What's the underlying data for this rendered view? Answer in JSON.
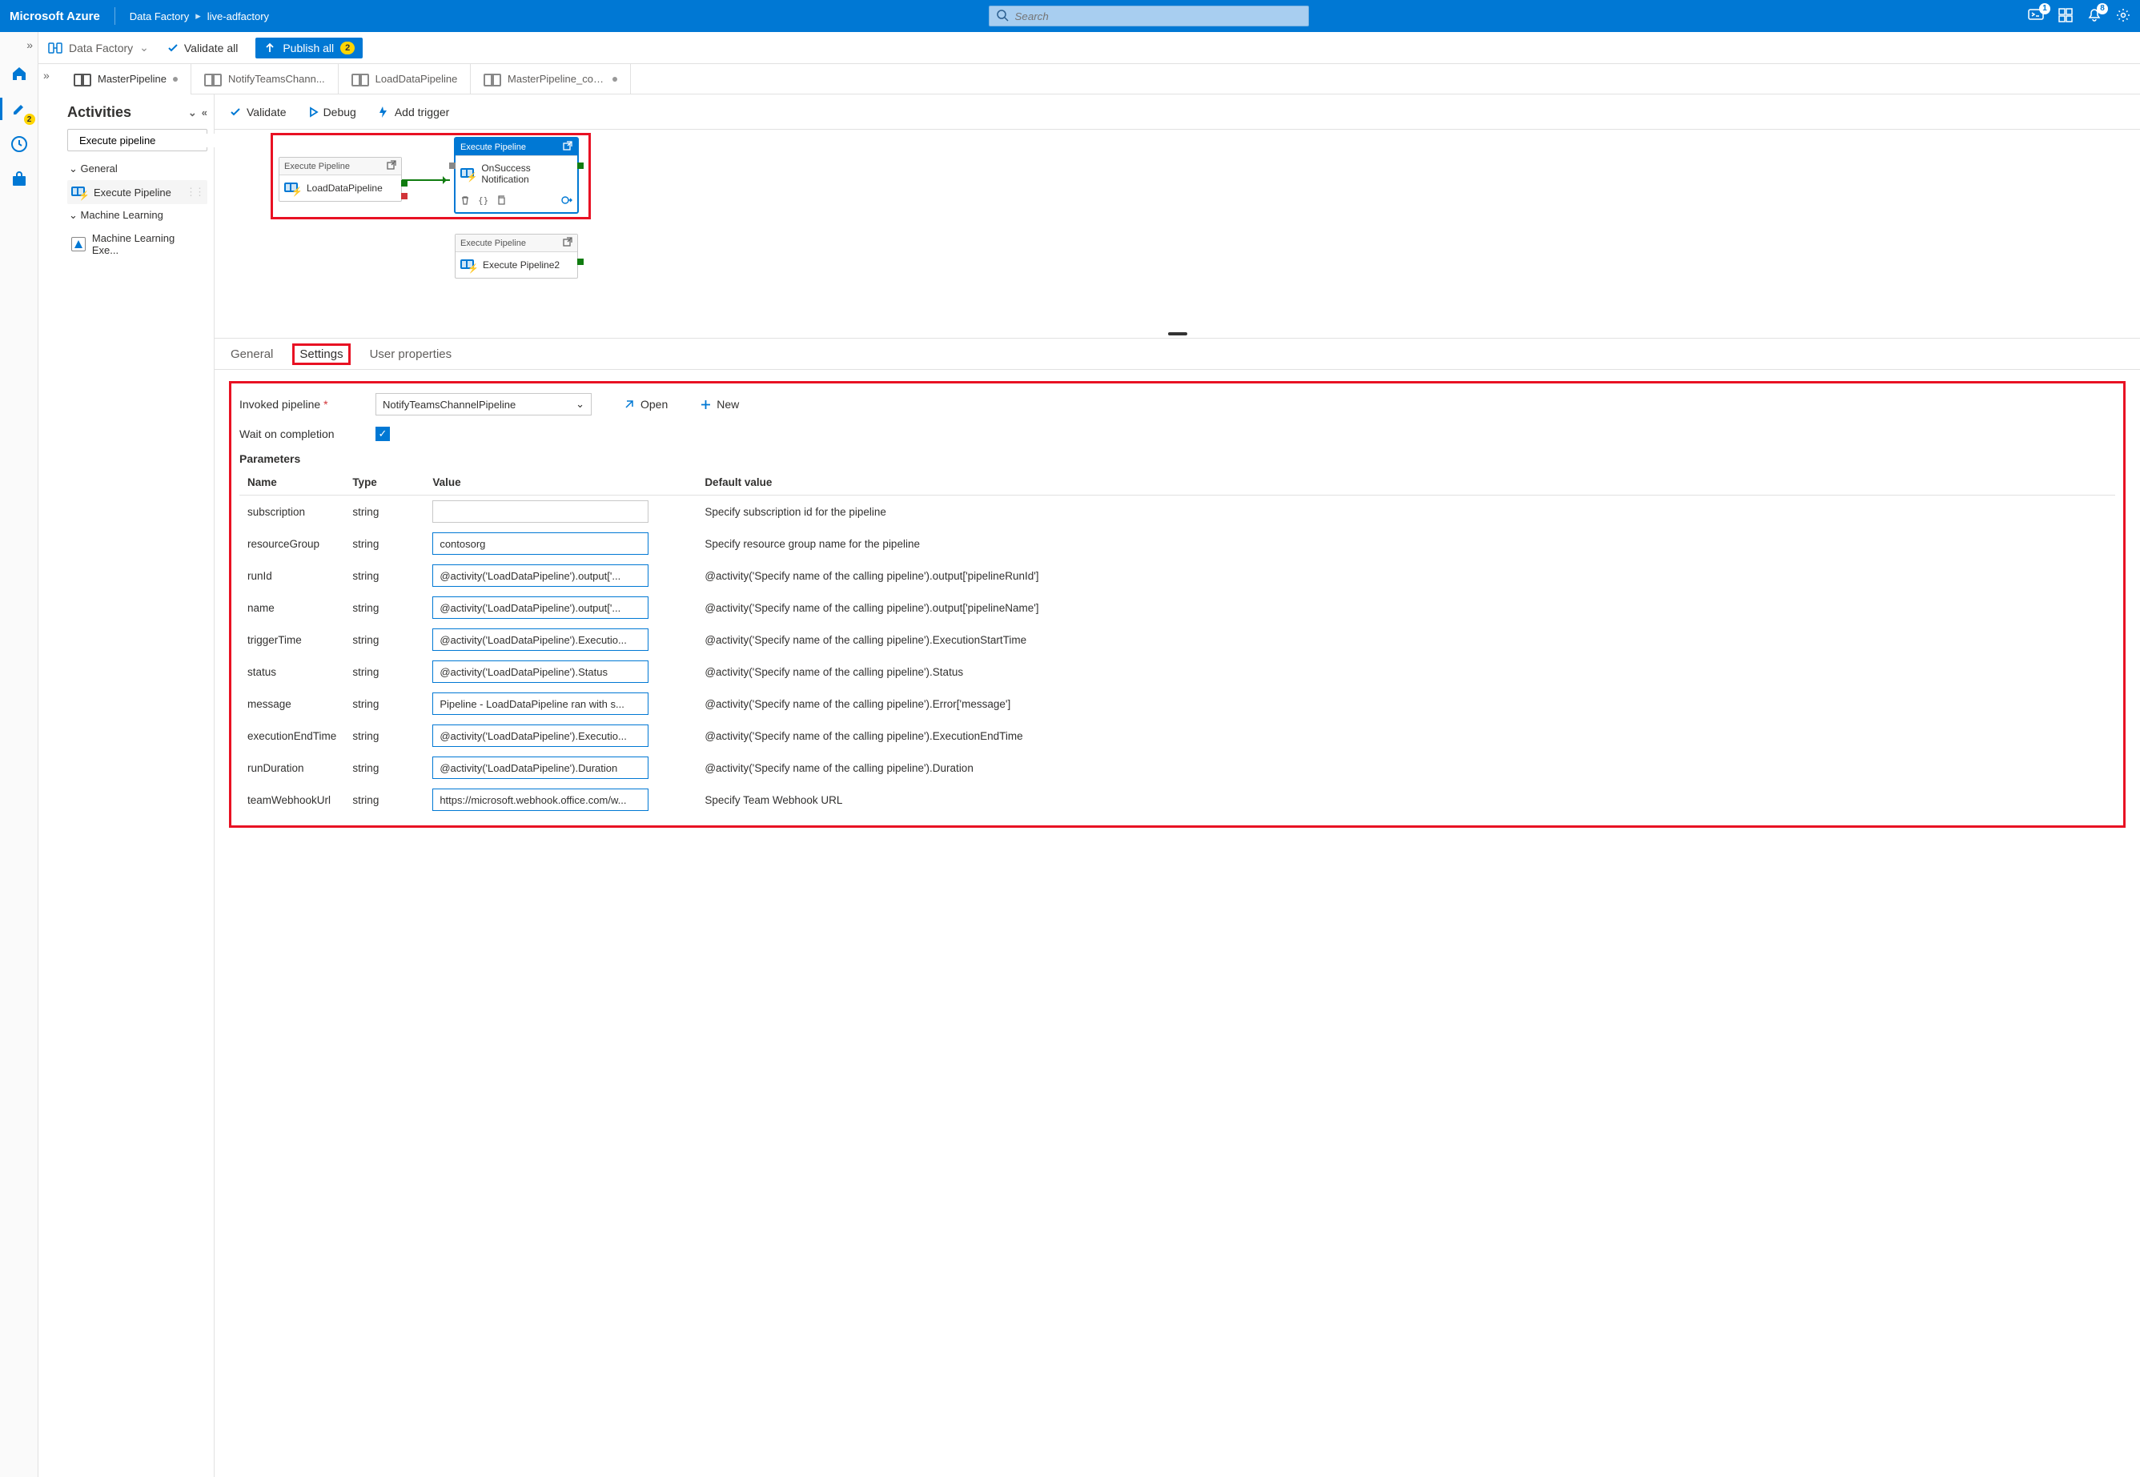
{
  "topbar": {
    "brand": "Microsoft Azure",
    "breadcrumb": [
      "Data Factory",
      "live-adfactory"
    ],
    "search_placeholder": "Search",
    "badges": {
      "chat": "1",
      "bell": "8"
    }
  },
  "cmdbar": {
    "scope": "Data Factory",
    "validate_all": "Validate all",
    "publish_all": "Publish all",
    "publish_count": "2"
  },
  "leftrail": {
    "pencil_count": "2"
  },
  "tabs": [
    {
      "label": "MasterPipeline",
      "dirty": true,
      "active": true
    },
    {
      "label": "NotifyTeamsChann...",
      "dirty": false,
      "active": false
    },
    {
      "label": "LoadDataPipeline",
      "dirty": false,
      "active": false
    },
    {
      "label": "MasterPipeline_cop...",
      "dirty": true,
      "active": false
    }
  ],
  "activities": {
    "title": "Activities",
    "search_value": "Execute pipeline",
    "groups": [
      {
        "name": "General",
        "items": [
          {
            "label": "Execute Pipeline",
            "icon": "exec"
          }
        ]
      },
      {
        "name": "Machine Learning",
        "items": [
          {
            "label": "Machine Learning Exe...",
            "icon": "ml"
          }
        ]
      }
    ]
  },
  "canvas_toolbar": {
    "validate": "Validate",
    "debug": "Debug",
    "add_trigger": "Add trigger"
  },
  "nodes": {
    "n1": {
      "type": "Execute Pipeline",
      "title": "LoadDataPipeline"
    },
    "n2": {
      "type": "Execute Pipeline",
      "title": "OnSuccess Notification"
    },
    "n3": {
      "type": "Execute Pipeline",
      "title": "Execute Pipeline2"
    }
  },
  "detail_tabs": [
    "General",
    "Settings",
    "User properties"
  ],
  "settings": {
    "invoked_label": "Invoked pipeline",
    "invoked_value": "NotifyTeamsChannelPipeline",
    "open": "Open",
    "new": "New",
    "wait_label": "Wait on completion",
    "wait_checked": true,
    "params_label": "Parameters",
    "columns": {
      "name": "Name",
      "type": "Type",
      "value": "Value",
      "default": "Default value"
    },
    "rows": [
      {
        "name": "subscription",
        "type": "string",
        "value": "",
        "default": "Specify subscription id for the pipeline"
      },
      {
        "name": "resourceGroup",
        "type": "string",
        "value": "contosorg",
        "default": "Specify resource group name for the pipeline"
      },
      {
        "name": "runId",
        "type": "string",
        "value": "@activity('LoadDataPipeline').output['...",
        "default": "@activity('Specify name of the calling pipeline').output['pipelineRunId']"
      },
      {
        "name": "name",
        "type": "string",
        "value": "@activity('LoadDataPipeline').output['...",
        "default": "@activity('Specify name of the calling pipeline').output['pipelineName']"
      },
      {
        "name": "triggerTime",
        "type": "string",
        "value": "@activity('LoadDataPipeline').Executio...",
        "default": "@activity('Specify name of the calling pipeline').ExecutionStartTime"
      },
      {
        "name": "status",
        "type": "string",
        "value": "@activity('LoadDataPipeline').Status",
        "default": "@activity('Specify name of the calling pipeline').Status"
      },
      {
        "name": "message",
        "type": "string",
        "value": "Pipeline - LoadDataPipeline ran with s...",
        "default": "@activity('Specify name of the calling pipeline').Error['message']"
      },
      {
        "name": "executionEndTime",
        "type": "string",
        "value": "@activity('LoadDataPipeline').Executio...",
        "default": "@activity('Specify name of the calling pipeline').ExecutionEndTime"
      },
      {
        "name": "runDuration",
        "type": "string",
        "value": "@activity('LoadDataPipeline').Duration",
        "default": "@activity('Specify name of the calling pipeline').Duration"
      },
      {
        "name": "teamWebhookUrl",
        "type": "string",
        "value": "https://microsoft.webhook.office.com/w...",
        "default": "Specify Team Webhook URL"
      }
    ]
  }
}
